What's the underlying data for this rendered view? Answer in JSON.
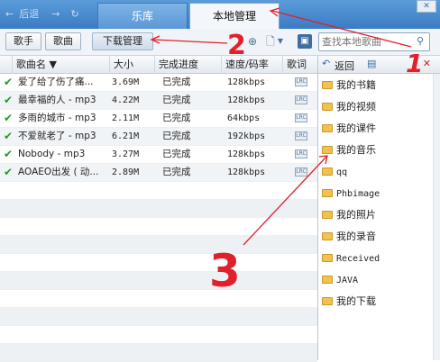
{
  "nav": {
    "back_label": "后退",
    "refresh_icon": "refresh-icon"
  },
  "tabs": [
    {
      "label": "乐库"
    },
    {
      "label": "本地管理"
    }
  ],
  "toolbar": {
    "singer_label": "歌手",
    "song_label": "歌曲",
    "download_label": "下载管理"
  },
  "search": {
    "placeholder": "查找本地歌曲"
  },
  "table": {
    "headers": [
      "歌曲名 ▼",
      "大小",
      "完成进度",
      "速度/码率",
      "歌词"
    ],
    "rows": [
      {
        "name": "爱了给了伤了痛...",
        "size": "3.69M",
        "status": "已完成",
        "rate": "128kbps"
      },
      {
        "name": "最幸福的人 - mp3",
        "size": "4.22M",
        "status": "已完成",
        "rate": "128kbps"
      },
      {
        "name": "多雨的城市 - mp3",
        "size": "2.11M",
        "status": "已完成",
        "rate": "64kbps"
      },
      {
        "name": "不爱就老了 - mp3",
        "size": "6.21M",
        "status": "已完成",
        "rate": "192kbps"
      },
      {
        "name": "Nobody - mp3",
        "size": "3.27M",
        "status": "已完成",
        "rate": "128kbps"
      },
      {
        "name": "AOAEO出发 ( 动...",
        "size": "2.89M",
        "status": "已完成",
        "rate": "128kbps"
      }
    ]
  },
  "sidebar": {
    "back_label": "返回",
    "folders": [
      "我的书籍",
      "我的视频",
      "我的课件",
      "我的音乐",
      "qq",
      "Phbimage",
      "我的照片",
      "我的录音",
      "Received",
      "JAVA",
      "我的下载"
    ]
  },
  "annotations": {
    "one": "1",
    "two": "2",
    "three": "3"
  },
  "colors": {
    "annotation": "#e0202a",
    "accent": "#3b7cc4",
    "check": "#1e9a29"
  }
}
